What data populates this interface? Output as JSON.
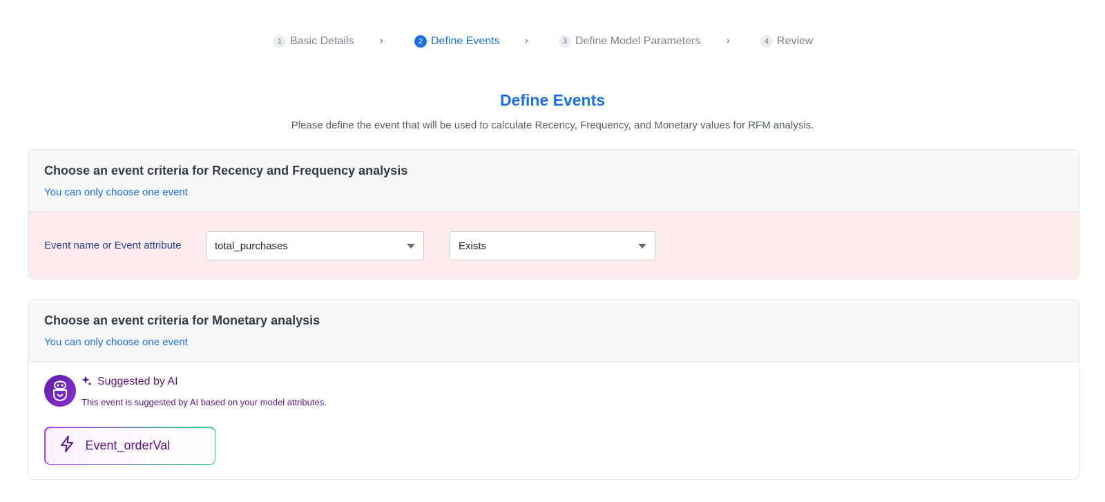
{
  "stepper": {
    "steps": [
      {
        "number": "1",
        "label": "Basic Details",
        "state": "inactive"
      },
      {
        "number": "2",
        "label": "Define Events",
        "state": "active"
      },
      {
        "number": "3",
        "label": "Define Model Parameters",
        "state": "inactive"
      },
      {
        "number": "4",
        "label": "Review",
        "state": "inactive"
      }
    ],
    "separator_icon": "chevron-right-icon"
  },
  "header": {
    "title": "Define Events",
    "subtitle": "Please define the event that will be used to calculate Recency, Frequency, and Monetary values for RFM analysis."
  },
  "recency_frequency": {
    "title": "Choose an event criteria for Recency and Frequency analysis",
    "hint": "You can only choose one event",
    "field_label": "Event name or Event attribute",
    "event_select": {
      "value": "total_purchases"
    },
    "operator_select": {
      "value": "Exists"
    }
  },
  "monetary": {
    "title": "Choose an event criteria for Monetary analysis",
    "hint": "You can only choose one event",
    "ai": {
      "title": "Suggested by AI",
      "description": "This event is suggested by AI based on your model attributes.",
      "avatar_icon": "robot-icon",
      "sparkle_icon": "sparkle-icon"
    },
    "suggested_event": {
      "label": "Event_orderVal",
      "icon": "lightning-icon"
    }
  },
  "colors": {
    "accent": "#1a6ee6",
    "error_background": "#fdeceb",
    "ai_purple": "#5c1480",
    "chip_gradient_start": "#b23ff5",
    "chip_gradient_end": "#1fd17a"
  }
}
